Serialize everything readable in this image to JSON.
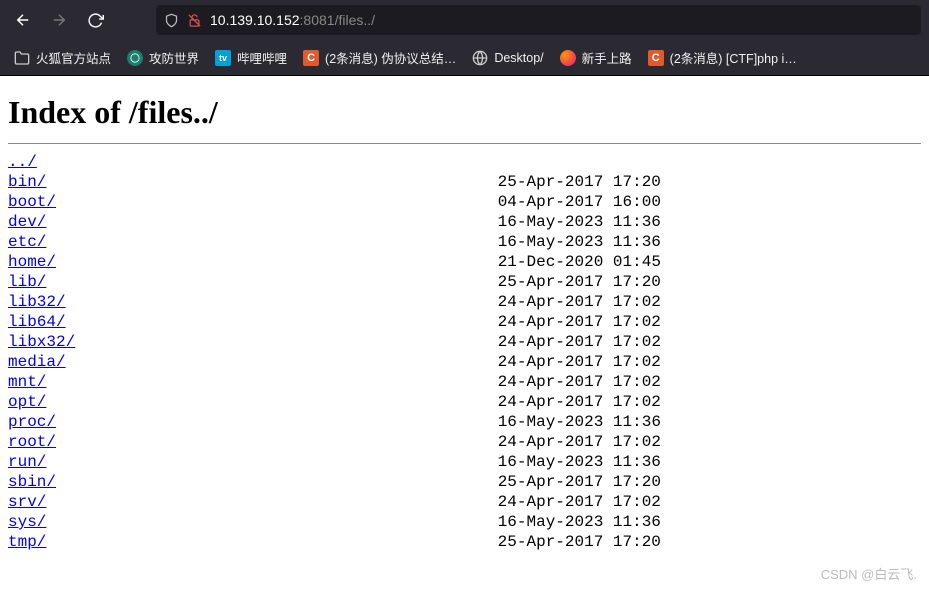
{
  "toolbar": {
    "url_host": "10.139.10.152",
    "url_port": ":8081",
    "url_path": "/files../"
  },
  "bookmarks": [
    {
      "label": "火狐官方站点",
      "icon": "folder",
      "bg": "",
      "fg": "#ccc"
    },
    {
      "label": "攻防世界",
      "icon": "globe",
      "bg": "#1a7f6e",
      "fg": "#fff"
    },
    {
      "label": "哔哩哔哩",
      "icon": "bili",
      "bg": "#00a1d6",
      "fg": "#fff"
    },
    {
      "label": "(2条消息) 伪协议总结…",
      "icon": "C",
      "bg": "#e05a2b",
      "fg": "#fff"
    },
    {
      "label": "Desktop/",
      "icon": "globe2",
      "bg": "",
      "fg": "#ccc"
    },
    {
      "label": "新手上路",
      "icon": "ff",
      "bg": "",
      "fg": ""
    },
    {
      "label": "(2条消息) [CTF]php i…",
      "icon": "C",
      "bg": "#e05a2b",
      "fg": "#fff"
    }
  ],
  "page": {
    "heading": "Index of /files../"
  },
  "listing": [
    {
      "name": "../",
      "date": "",
      "size": ""
    },
    {
      "name": "bin/",
      "date": "25-Apr-2017 17:20",
      "size": "-"
    },
    {
      "name": "boot/",
      "date": "04-Apr-2017 16:00",
      "size": "-"
    },
    {
      "name": "dev/",
      "date": "16-May-2023 11:36",
      "size": "-"
    },
    {
      "name": "etc/",
      "date": "16-May-2023 11:36",
      "size": "-"
    },
    {
      "name": "home/",
      "date": "21-Dec-2020 01:45",
      "size": "-"
    },
    {
      "name": "lib/",
      "date": "25-Apr-2017 17:20",
      "size": "-"
    },
    {
      "name": "lib32/",
      "date": "24-Apr-2017 17:02",
      "size": "-"
    },
    {
      "name": "lib64/",
      "date": "24-Apr-2017 17:02",
      "size": "-"
    },
    {
      "name": "libx32/",
      "date": "24-Apr-2017 17:02",
      "size": "-"
    },
    {
      "name": "media/",
      "date": "24-Apr-2017 17:02",
      "size": "-"
    },
    {
      "name": "mnt/",
      "date": "24-Apr-2017 17:02",
      "size": "-"
    },
    {
      "name": "opt/",
      "date": "24-Apr-2017 17:02",
      "size": "-"
    },
    {
      "name": "proc/",
      "date": "16-May-2023 11:36",
      "size": "-"
    },
    {
      "name": "root/",
      "date": "24-Apr-2017 17:02",
      "size": "-"
    },
    {
      "name": "run/",
      "date": "16-May-2023 11:36",
      "size": "-"
    },
    {
      "name": "sbin/",
      "date": "25-Apr-2017 17:20",
      "size": "-"
    },
    {
      "name": "srv/",
      "date": "24-Apr-2017 17:02",
      "size": "-"
    },
    {
      "name": "sys/",
      "date": "16-May-2023 11:36",
      "size": "-"
    },
    {
      "name": "tmp/",
      "date": "25-Apr-2017 17:20",
      "size": "-"
    }
  ],
  "watermark": "CSDN @白云飞."
}
